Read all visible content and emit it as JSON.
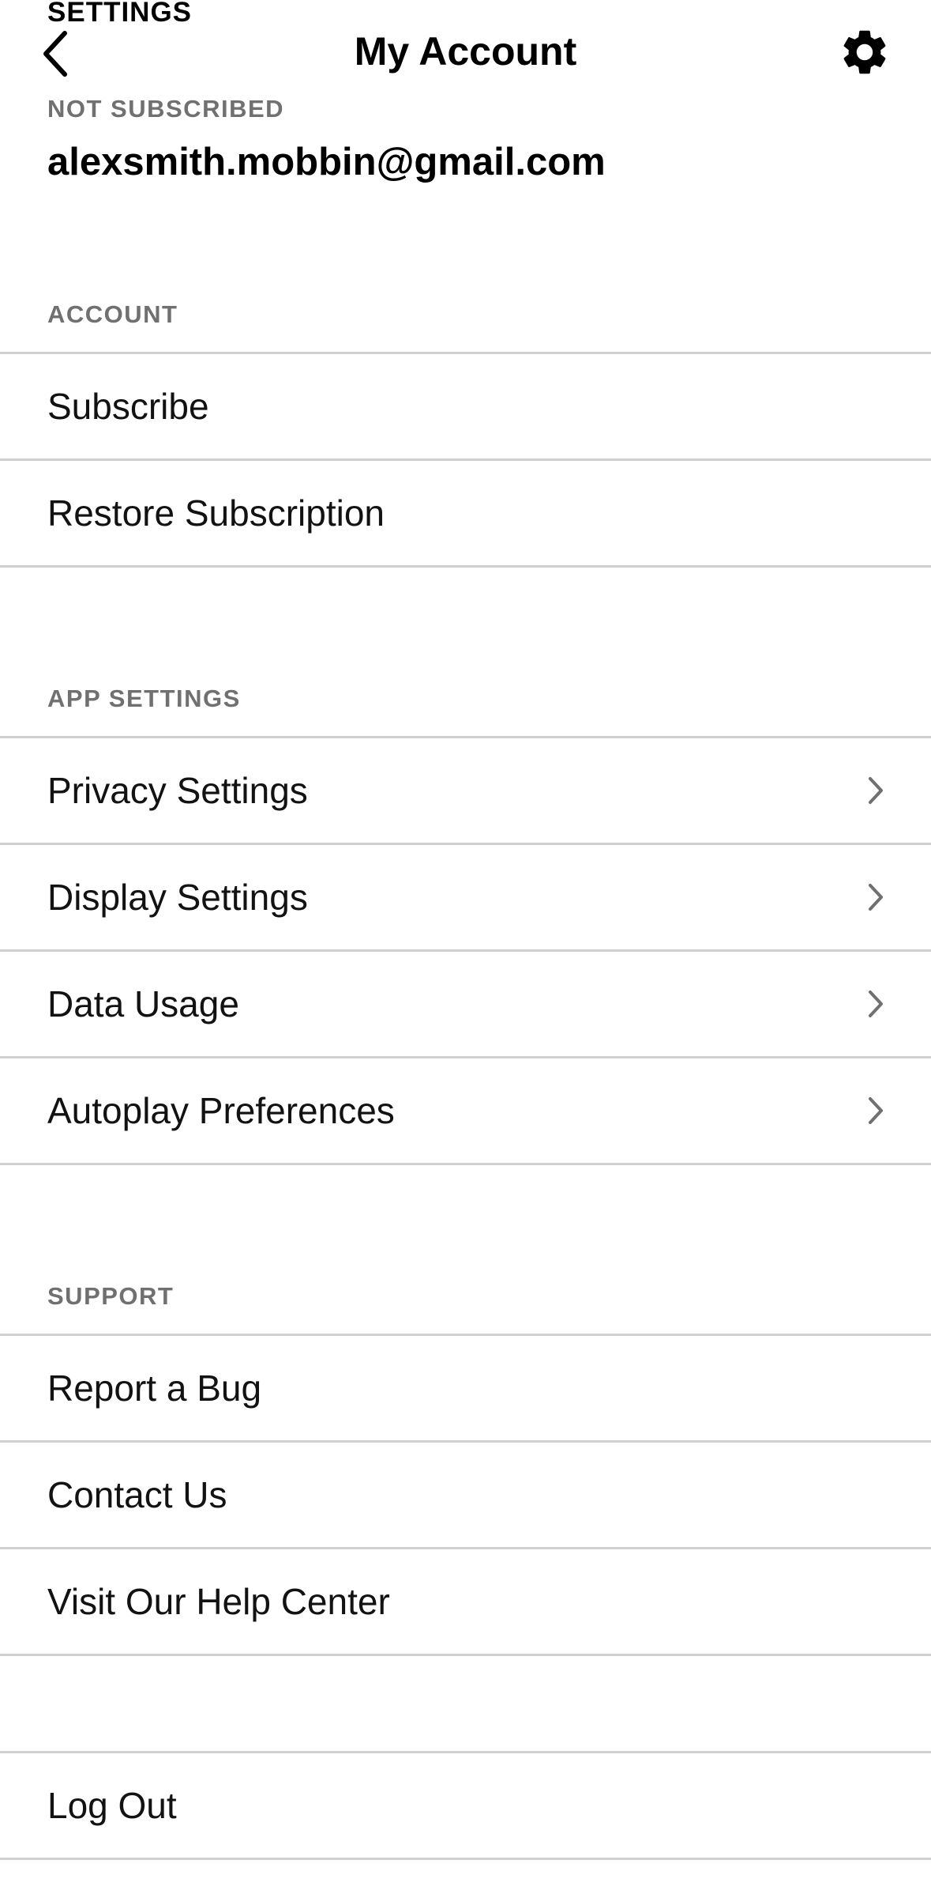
{
  "header": {
    "overline": "SETTINGS",
    "title": "My Account",
    "back_icon": "chevron-left-icon",
    "settings_icon": "gear-icon"
  },
  "account_status": {
    "label": "NOT SUBSCRIBED",
    "email": "alexsmith.mobbin@gmail.com"
  },
  "sections": {
    "account": {
      "title": "ACCOUNT",
      "items": [
        {
          "label": "Subscribe"
        },
        {
          "label": "Restore Subscription"
        }
      ]
    },
    "app_settings": {
      "title": "APP SETTINGS",
      "items": [
        {
          "label": "Privacy Settings",
          "icon": "chevron-right-icon"
        },
        {
          "label": "Display Settings",
          "icon": "chevron-right-icon"
        },
        {
          "label": "Data Usage",
          "icon": "chevron-right-icon"
        },
        {
          "label": "Autoplay Preferences",
          "icon": "chevron-right-icon"
        }
      ]
    },
    "support": {
      "title": "SUPPORT",
      "items": [
        {
          "label": "Report a Bug"
        },
        {
          "label": "Contact Us"
        },
        {
          "label": "Visit Our Help Center"
        }
      ]
    },
    "logout": {
      "label": "Log Out"
    }
  },
  "colors": {
    "section_label": "#707070",
    "divider": "#d0d0d0",
    "chevron": "#707070"
  }
}
